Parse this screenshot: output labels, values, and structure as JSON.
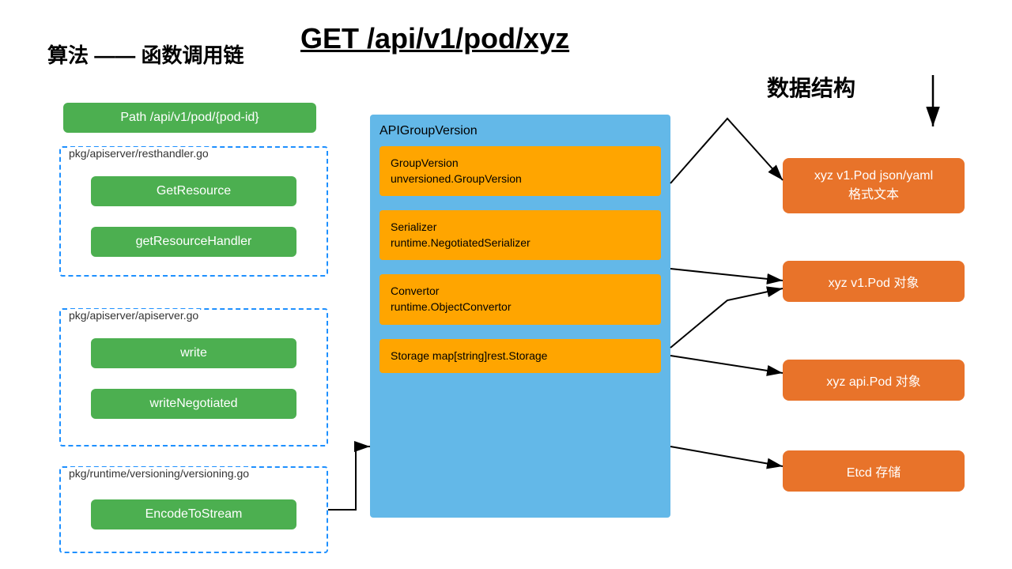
{
  "header": {
    "title": "GET /api/v1/pod/xyz"
  },
  "left_section": {
    "label": "算法 —— 函数调用链",
    "path_btn": "Path /api/v1/pod/{pod-id}",
    "box1": {
      "label": "pkg/apiserver/resthandler.go",
      "btn1": "GetResource",
      "btn2": "getResourceHandler"
    },
    "box2": {
      "label": "pkg/apiserver/apiserver.go",
      "btn1": "write",
      "btn2": "writeNegotiated"
    },
    "box3": {
      "label": "pkg/runtime/versioning/versioning.go",
      "btn1": "EncodeToStream"
    }
  },
  "center": {
    "label": "APIGroupVersion",
    "items": [
      {
        "line1": "GroupVersion",
        "line2": "unversioned.GroupVersion"
      },
      {
        "line1": "Serializer",
        "line2": "runtime.NegotiatedSerializer"
      },
      {
        "line1": "Convertor",
        "line2": "runtime.ObjectConvertor"
      },
      {
        "line1": "Storage map[string]rest.Storage",
        "line2": ""
      }
    ]
  },
  "right_section": {
    "label": "数据结构",
    "items": [
      "xyz  v1.Pod json/yaml\n格式文本",
      "xyz  v1.Pod 对象",
      "xyz  api.Pod 对象",
      "Etcd 存储"
    ]
  }
}
